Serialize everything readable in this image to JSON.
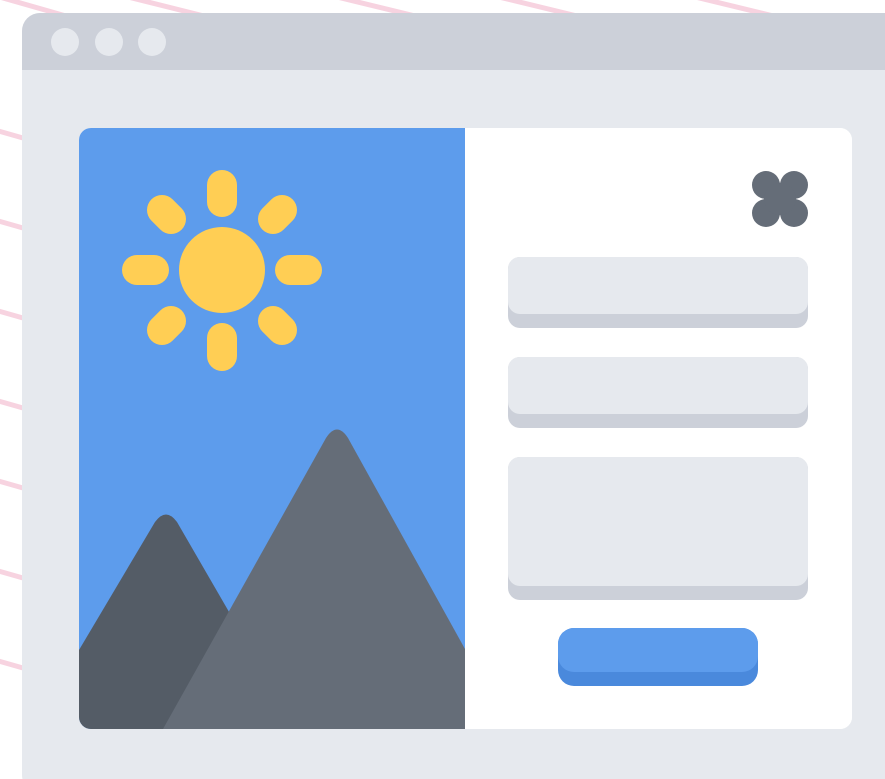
{
  "window": {
    "controls": [
      "dot",
      "dot",
      "dot"
    ]
  },
  "modal": {
    "image": {
      "icons": [
        "sun-icon",
        "mountain-icon"
      ]
    },
    "close_icon": "close-icon",
    "fields": {
      "name": {
        "value": "",
        "placeholder": ""
      },
      "email": {
        "value": "",
        "placeholder": ""
      },
      "message": {
        "value": "",
        "placeholder": ""
      }
    },
    "submit_label": ""
  },
  "colors": {
    "background_stripe": "#f7d3e0",
    "window": "#e6e9ee",
    "titlebar": "#ccd0d9",
    "sky": "#5d9cec",
    "sun": "#ffce54",
    "mountain_front": "#656d78",
    "mountain_back": "#545c66",
    "field": "#e6e9ee",
    "field_shadow": "#ccd0d9",
    "button": "#5d9cec",
    "button_shadow": "#4a89dc",
    "close": "#656d78"
  }
}
